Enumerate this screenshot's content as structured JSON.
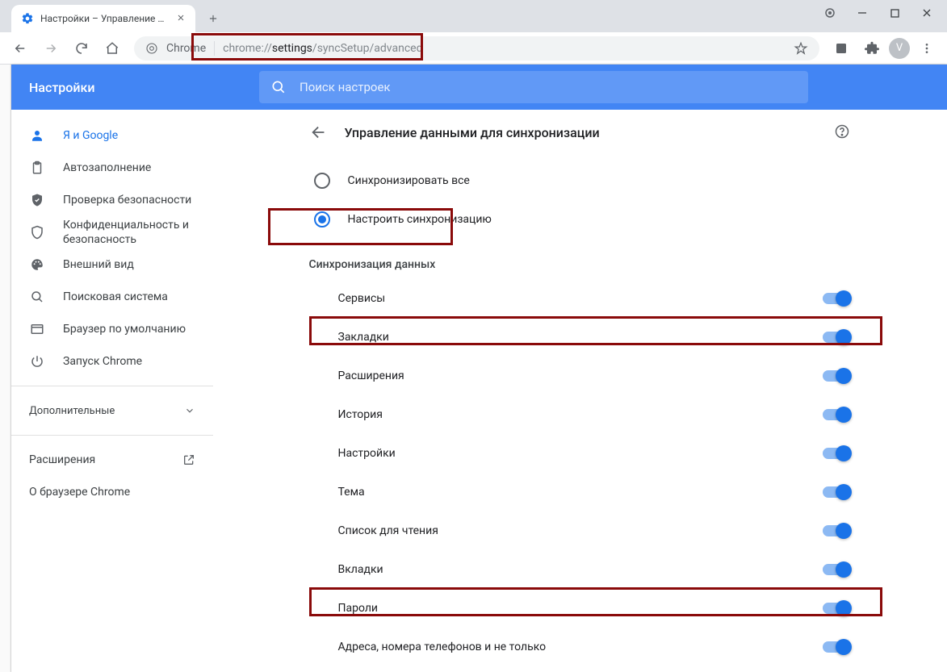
{
  "window": {
    "tab_title": "Настройки – Управление данны",
    "url_prefix": "Chrome",
    "url_muted1": "chrome://",
    "url_strong": "settings",
    "url_muted2": "/syncSetup/advanced",
    "avatar_letter": "V"
  },
  "appbar": {
    "brand": "Настройки",
    "search_placeholder": "Поиск настроек"
  },
  "sidebar": {
    "items": [
      {
        "icon": "person",
        "label": "Я и Google",
        "active": true
      },
      {
        "icon": "clipboard",
        "label": "Автозаполнение"
      },
      {
        "icon": "shield-check",
        "label": "Проверка безопасности"
      },
      {
        "icon": "shield",
        "label": "Конфиденциальность и безопасность"
      },
      {
        "icon": "palette",
        "label": "Внешний вид"
      },
      {
        "icon": "search",
        "label": "Поисковая система"
      },
      {
        "icon": "window",
        "label": "Браузер по умолчанию"
      },
      {
        "icon": "power",
        "label": "Запуск Chrome"
      }
    ],
    "advanced": "Дополнительные",
    "extensions": "Расширения",
    "about": "О браузере Chrome"
  },
  "page": {
    "title": "Управление данными для синхронизации",
    "radio": [
      {
        "label": "Синхронизировать все",
        "selected": false
      },
      {
        "label": "Настроить синхронизацию",
        "selected": true
      }
    ],
    "subhead": "Синхронизация данных",
    "toggles": [
      {
        "label": "Сервисы",
        "on": true
      },
      {
        "label": "Закладки",
        "on": true,
        "highlight": true
      },
      {
        "label": "Расширения",
        "on": true
      },
      {
        "label": "История",
        "on": true
      },
      {
        "label": "Настройки",
        "on": true
      },
      {
        "label": "Тема",
        "on": true
      },
      {
        "label": "Список для чтения",
        "on": true
      },
      {
        "label": "Вкладки",
        "on": true
      },
      {
        "label": "Пароли",
        "on": true,
        "highlight": true
      },
      {
        "label": "Адреса, номера телефонов и не только",
        "on": true
      }
    ]
  }
}
